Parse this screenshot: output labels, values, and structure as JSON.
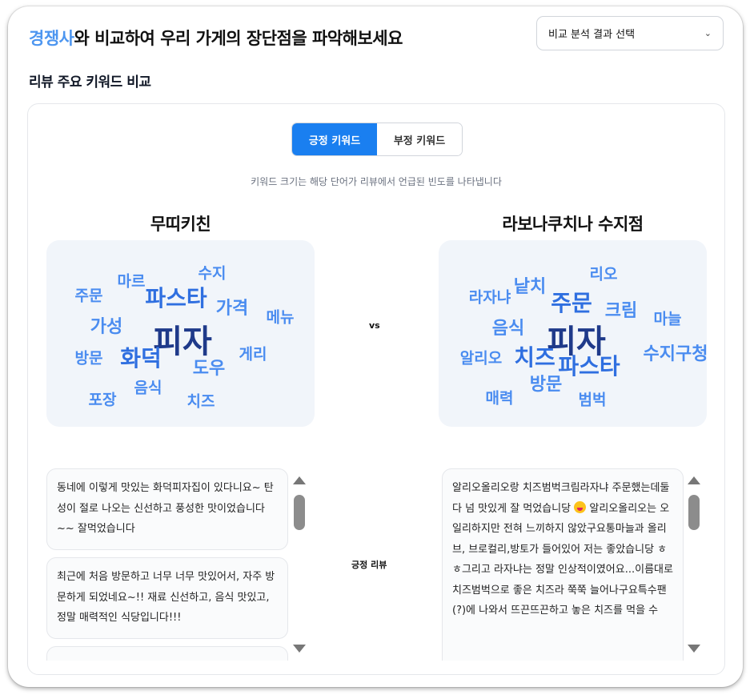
{
  "header": {
    "accent": "경쟁사",
    "title_rest": "와 비교하여 우리 가게의 장단점을 파악해보세요",
    "select_label": "비교 분석 결과 선택",
    "select_chevron_icon": "chevron-down-icon"
  },
  "section": {
    "title": "리뷰 주요 키워드 비교"
  },
  "toggle": {
    "positive": "긍정 키워드",
    "negative": "부정 키워드",
    "active": "positive"
  },
  "note": "키워드 크기는 해당 단어가 리뷰에서 언급된 빈도를 나타냅니다",
  "vs": "vs",
  "mid_label": "긍정 리뷰",
  "colors": {
    "accent": "#4d96f0",
    "toggle_active": "#1a7ff0",
    "keyword_main": "#1f3a8a",
    "keyword_mid": "#2f6fe0",
    "keyword_light": "#4a8cf0",
    "cloud_bg": "#f1f5fa"
  },
  "left": {
    "name": "무띠키친",
    "keywords": [
      {
        "text": "피자",
        "weight": 5
      },
      {
        "text": "화덕",
        "weight": 3
      },
      {
        "text": "파스타",
        "weight": 3
      },
      {
        "text": "가격",
        "weight": 2
      },
      {
        "text": "가성",
        "weight": 2
      },
      {
        "text": "도우",
        "weight": 2
      },
      {
        "text": "마르",
        "weight": 1
      },
      {
        "text": "수지",
        "weight": 1
      },
      {
        "text": "주문",
        "weight": 1
      },
      {
        "text": "메뉴",
        "weight": 1
      },
      {
        "text": "방문",
        "weight": 1
      },
      {
        "text": "게리",
        "weight": 1
      },
      {
        "text": "음식",
        "weight": 1
      },
      {
        "text": "포장",
        "weight": 1
      },
      {
        "text": "치즈",
        "weight": 1
      }
    ],
    "reviews": [
      "동네에 이렇게 맛있는 화덕피자집이 있다니요~ 탄성이 절로 나오는 신선하고 풍성한 맛이었습니다~~ 잘먹었습니다",
      "최근에 처음 방문하고 너무 너무 맛있어서, 자주 방문하게 되었네요~!! 재료 신선하고, 음식 맛있고, 정말 매력적인 식당입니다!!!",
      ""
    ]
  },
  "right": {
    "name": "라보나쿠치나 수지점",
    "keywords": [
      {
        "text": "피자",
        "weight": 5
      },
      {
        "text": "주문",
        "weight": 3
      },
      {
        "text": "치즈",
        "weight": 3
      },
      {
        "text": "파스타",
        "weight": 3
      },
      {
        "text": "음식",
        "weight": 2
      },
      {
        "text": "크림",
        "weight": 2
      },
      {
        "text": "낱치",
        "weight": 2
      },
      {
        "text": "리오",
        "weight": 1
      },
      {
        "text": "라자냐",
        "weight": 1
      },
      {
        "text": "마늘",
        "weight": 1
      },
      {
        "text": "알리오",
        "weight": 1
      },
      {
        "text": "수지구청",
        "weight": 2
      },
      {
        "text": "방문",
        "weight": 2
      },
      {
        "text": "매력",
        "weight": 1
      },
      {
        "text": "범벅",
        "weight": 1
      }
    ],
    "review_parts": [
      "알리오올리오랑 치즈범벅크림라자냐 주문했는데둘다 넘 맛있게 잘 먹었습니당",
      "알리오올리오는 오일리하지만 전혀 느끼하지 않았구요통마늘과 올리브, 브로컬리,방토가 들어있어 저는 좋았습니당 ㅎㅎ그리고 라자냐는 정말 인상적이였어요...이름대로 치즈범벅으로 좋은 치즈라 쭉쭉 늘어나구요특수팬(?)에 나와서 뜨끈뜨끈하고 놓은 치즈를 먹을 수"
    ],
    "emoji_icon": "smiling-face-icon"
  }
}
